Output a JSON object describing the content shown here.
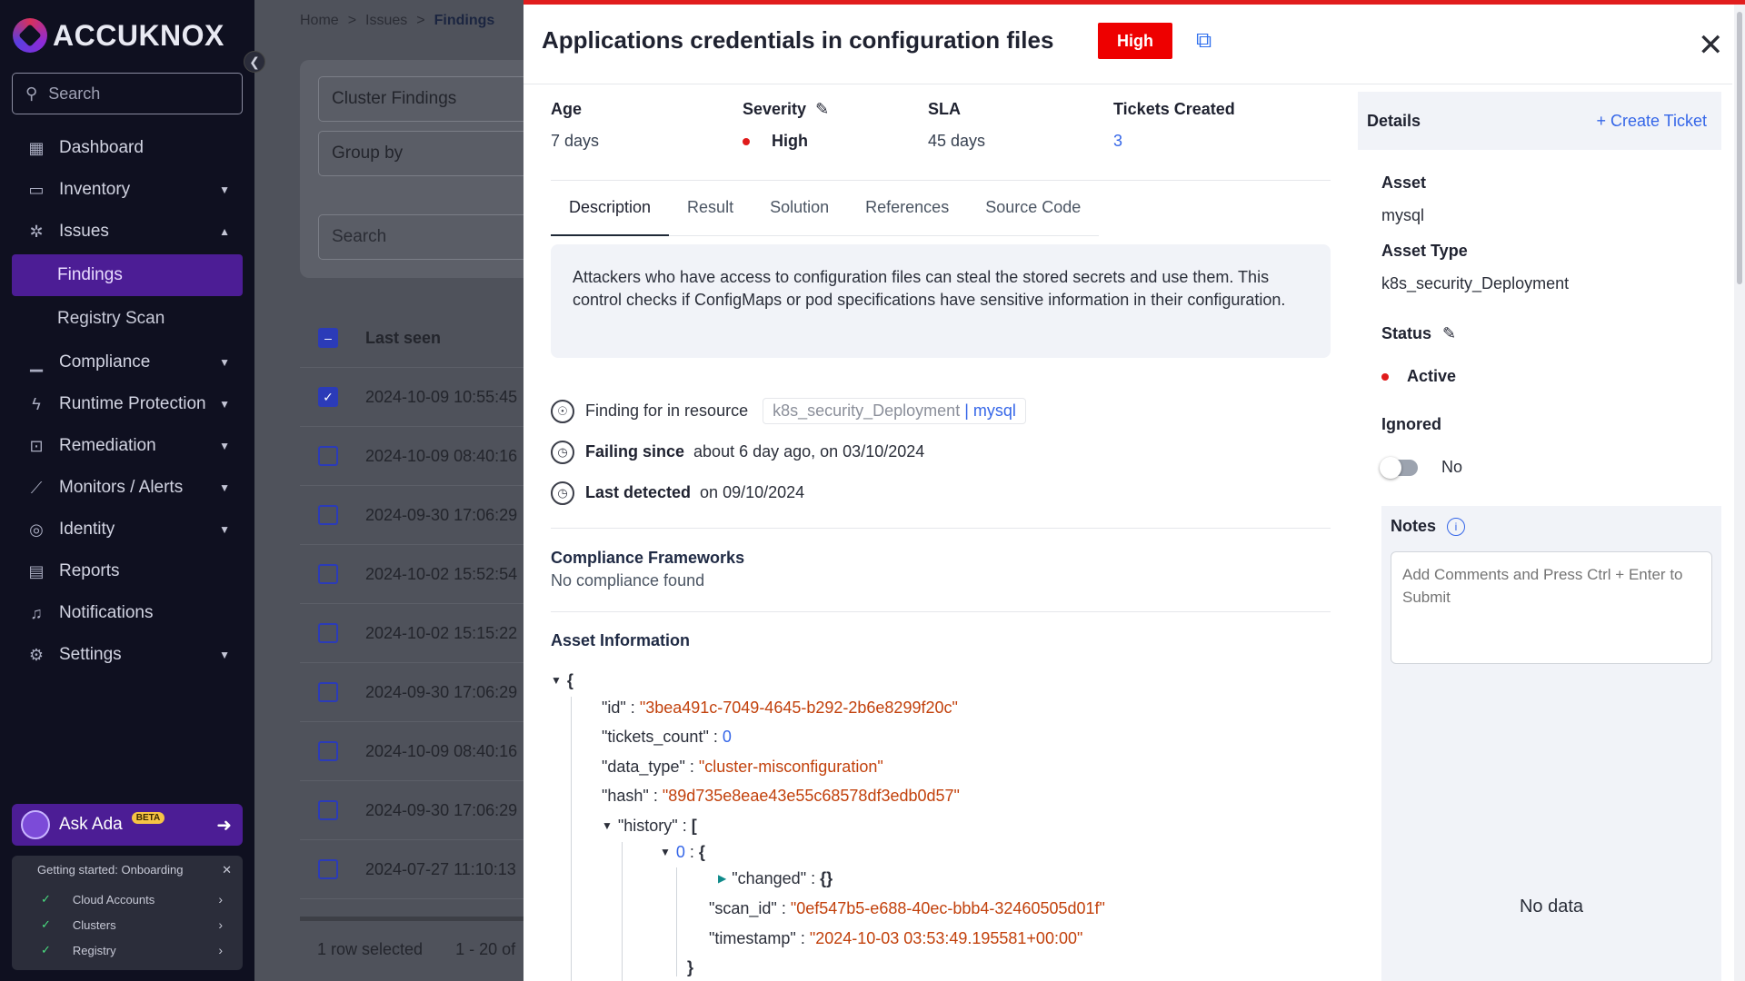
{
  "sidebar": {
    "brand": "ACCUKNOX",
    "search_placeholder": "Search",
    "items": [
      {
        "label": "Dashboard",
        "icon": "dashboard-icon",
        "glyph": "▦"
      },
      {
        "label": "Inventory",
        "icon": "inventory-icon",
        "glyph": "▭"
      },
      {
        "label": "Issues",
        "icon": "bug-icon",
        "glyph": "✲"
      }
    ],
    "issues_sub": [
      "Findings",
      "Registry Scan"
    ],
    "items2": [
      {
        "label": "Compliance",
        "icon": "compliance-icon",
        "glyph": "▁"
      },
      {
        "label": "Runtime Protection",
        "icon": "bolt-icon",
        "glyph": "ϟ"
      },
      {
        "label": "Remediation",
        "icon": "lock-icon",
        "glyph": "⊡"
      },
      {
        "label": "Monitors / Alerts",
        "icon": "chart-icon",
        "glyph": "⟋"
      },
      {
        "label": "Identity",
        "icon": "fingerprint-icon",
        "glyph": "◎"
      },
      {
        "label": "Reports",
        "icon": "report-icon",
        "glyph": "▤"
      },
      {
        "label": "Notifications",
        "icon": "bell-icon",
        "glyph": "♫"
      },
      {
        "label": "Settings",
        "icon": "gear-icon",
        "glyph": "⚙"
      }
    ],
    "ask_ada": "Ask Ada",
    "beta": "BETA",
    "onboarding": {
      "title": "Getting started: Onboarding",
      "steps": [
        "Cloud Accounts",
        "Clusters",
        "Registry"
      ]
    }
  },
  "background": {
    "breadcrumb": [
      "Home",
      "Issues",
      "Findings"
    ],
    "cluster_findings": "Cluster Findings",
    "group_by": "Group by",
    "search_placeholder": "Search",
    "column_header": "Last seen",
    "rows": [
      {
        "time": "2024-10-09 10:55:45",
        "checked": true
      },
      {
        "time": "2024-10-09 08:40:16",
        "checked": false
      },
      {
        "time": "2024-09-30 17:06:29",
        "checked": false
      },
      {
        "time": "2024-10-02 15:52:54",
        "checked": false
      },
      {
        "time": "2024-10-02 15:15:22",
        "checked": false
      },
      {
        "time": "2024-09-30 17:06:29",
        "checked": false
      },
      {
        "time": "2024-10-09 08:40:16",
        "checked": false
      },
      {
        "time": "2024-09-30 17:06:29",
        "checked": false
      },
      {
        "time": "2024-07-27 11:10:13",
        "checked": false
      }
    ],
    "row_selected": "1 row selected",
    "pagination": "1 - 20 of"
  },
  "drawer": {
    "title": "Applications credentials in configuration files",
    "severity_badge": "High",
    "meta": {
      "age_label": "Age",
      "age_value": "7 days",
      "severity_label": "Severity",
      "severity_value": "High",
      "sla_label": "SLA",
      "sla_value": "45 days",
      "tickets_label": "Tickets Created",
      "tickets_value": "3"
    },
    "tabs": [
      "Description",
      "Result",
      "Solution",
      "References",
      "Source Code"
    ],
    "description": "Attackers who have access to configuration files can steal the stored secrets and use them. This control checks if ConfigMaps or pod specifications have sensitive information in their configuration.",
    "finding_for_label": "Finding for in resource",
    "resource_type": "k8s_security_Deployment",
    "resource_sep": "|",
    "resource_name": "mysql",
    "failing_since_label": "Failing since",
    "failing_since_value": "about 6 day ago, on 03/10/2024",
    "last_detected_label": "Last detected",
    "last_detected_value": "on 09/10/2024",
    "compliance_title": "Compliance Frameworks",
    "compliance_value": "No compliance found",
    "asset_info_title": "Asset Information",
    "json": {
      "id_key": "\"id\"",
      "id_val": "\"3bea491c-7049-4645-b292-2b6e8299f20c\"",
      "tickets_key": "\"tickets_count\"",
      "tickets_val": "0",
      "data_type_key": "\"data_type\"",
      "data_type_val": "\"cluster-misconfiguration\"",
      "hash_key": "\"hash\"",
      "hash_val": "\"89d735e8eae43e55c68578df3edb0d57\"",
      "history_key": "\"history\"",
      "index_key": "0",
      "changed_key": "\"changed\"",
      "changed_val": "{}",
      "scan_id_key": "\"scan_id\"",
      "scan_id_val": "\"0ef547b5-e688-40ec-bbb4-32460505d01f\"",
      "timestamp_key": "\"timestamp\"",
      "timestamp_val": "\"2024-10-03 03:53:49.195581+00:00\""
    },
    "details": {
      "title": "Details",
      "create_ticket": "+ Create Ticket",
      "asset_label": "Asset",
      "asset_value": "mysql",
      "asset_type_label": "Asset Type",
      "asset_type_value": "k8s_security_Deployment",
      "status_label": "Status",
      "status_value": "Active",
      "ignored_label": "Ignored",
      "ignored_value": "No",
      "notes_label": "Notes",
      "notes_placeholder": "Add Comments and Press Ctrl + Enter to Submit",
      "no_data": "No data"
    },
    "colors": {
      "accent_red": "#ee0000",
      "link_blue": "#3566e8",
      "active_nav": "#4c1d95"
    }
  }
}
